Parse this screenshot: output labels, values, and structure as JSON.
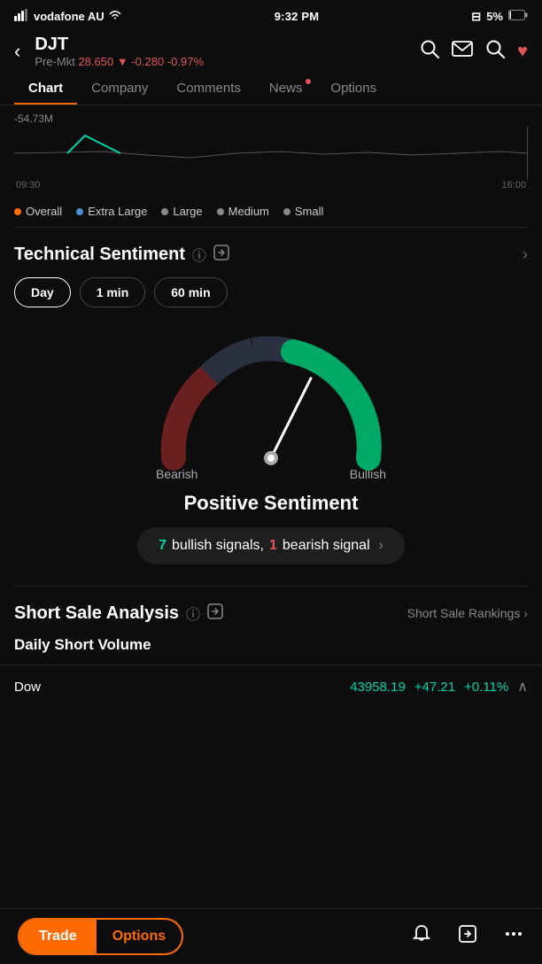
{
  "statusBar": {
    "carrier": "vodafone AU",
    "time": "9:32 PM",
    "battery": "5%"
  },
  "header": {
    "ticker": "DJT",
    "premarket": "Pre-Mkt",
    "price": "28.650",
    "change": "-0.280",
    "changePct": "-0.97%",
    "backLabel": "←"
  },
  "tabs": [
    {
      "id": "chart",
      "label": "Chart",
      "active": true,
      "dot": false
    },
    {
      "id": "company",
      "label": "Company",
      "active": false,
      "dot": false
    },
    {
      "id": "comments",
      "label": "Comments",
      "active": false,
      "dot": false
    },
    {
      "id": "news",
      "label": "News",
      "active": false,
      "dot": true
    },
    {
      "id": "options",
      "label": "Options",
      "active": false,
      "dot": false
    }
  ],
  "chart": {
    "yLabel": "-54.73M",
    "timeStart": "09:30",
    "timeEnd": "16:00"
  },
  "legend": [
    {
      "label": "Overall",
      "color": "#ff6b00"
    },
    {
      "label": "Extra Large",
      "color": "#4a90d9"
    },
    {
      "label": "Large",
      "color": "#888"
    },
    {
      "label": "Medium",
      "color": "#888"
    },
    {
      "label": "Small",
      "color": "#888"
    }
  ],
  "technicalSentiment": {
    "title": "Technical Sentiment",
    "infoIcon": "ⓘ",
    "shareIcon": "⬡",
    "timePeriods": [
      "Day",
      "1 min",
      "60 min"
    ],
    "activePeriod": "Day",
    "gauge": {
      "bearishLabel": "Bearish",
      "bullishLabel": "Bullish",
      "sentimentText": "Positive Sentiment",
      "bullishSignals": 7,
      "bearishSignals": 1,
      "bullishLabel2": "bullish signals,",
      "bearishLabel2": "bearish signal"
    }
  },
  "shortSale": {
    "title": "Short Sale Analysis",
    "infoIcon": "ⓘ",
    "shareIcon": "⬡",
    "rankingsLabel": "Short Sale Rankings",
    "subTitle": "Daily Short Volume",
    "dow": {
      "name": "Dow",
      "price": "43958.19",
      "change": "+47.21",
      "changePct": "+0.11%"
    }
  },
  "bottomBar": {
    "tradeLabel": "Trade",
    "optionsLabel": "Options"
  }
}
